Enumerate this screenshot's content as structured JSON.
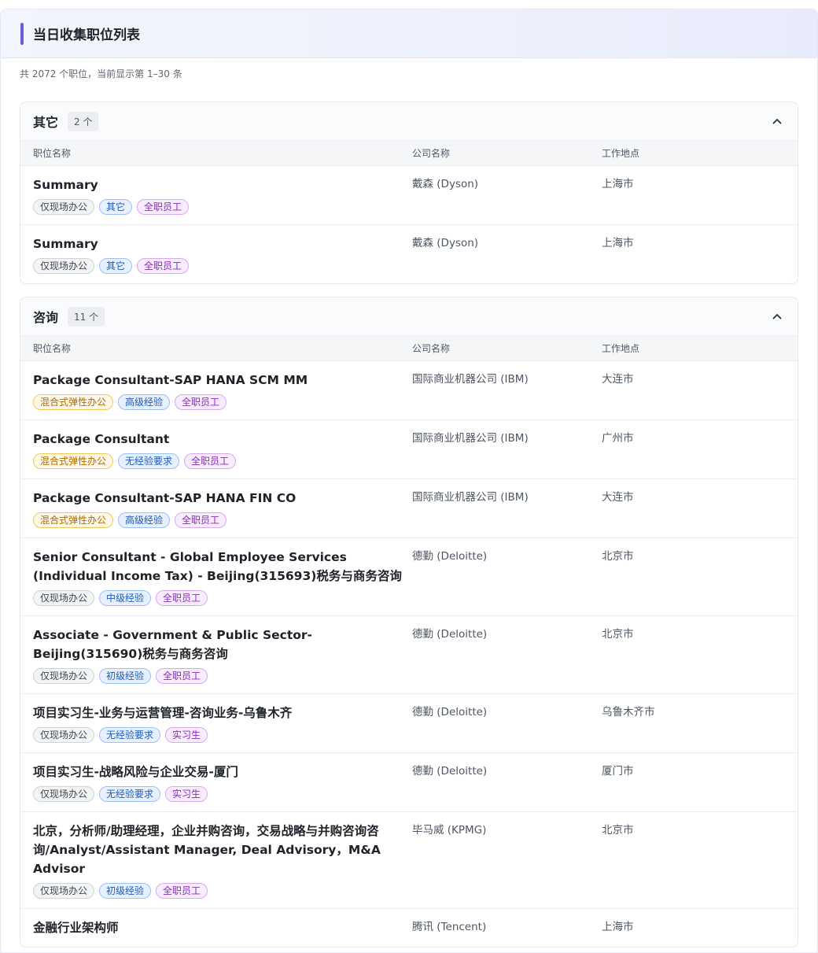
{
  "page": {
    "title": "当日收集职位列表",
    "summary": "共 2072 个职位，当前显示第 1–30 条"
  },
  "columns": {
    "title": "职位名称",
    "company": "公司名称",
    "location": "工作地点"
  },
  "groups": [
    {
      "name": "其它",
      "count": "2 个",
      "jobs": [
        {
          "title": "Summary",
          "company": "戴森 (Dyson)",
          "location": "上海市",
          "tags": [
            {
              "label": "仅现场办公",
              "tone": "gray"
            },
            {
              "label": "其它",
              "tone": "blue"
            },
            {
              "label": "全职员工",
              "tone": "purple"
            }
          ]
        },
        {
          "title": "Summary",
          "company": "戴森 (Dyson)",
          "location": "上海市",
          "tags": [
            {
              "label": "仅现场办公",
              "tone": "gray"
            },
            {
              "label": "其它",
              "tone": "blue"
            },
            {
              "label": "全职员工",
              "tone": "purple"
            }
          ]
        }
      ]
    },
    {
      "name": "咨询",
      "count": "11 个",
      "jobs": [
        {
          "title": "Package Consultant-SAP HANA SCM MM",
          "company": "国际商业机器公司 (IBM)",
          "location": "大连市",
          "tags": [
            {
              "label": "混合式弹性办公",
              "tone": "yellow"
            },
            {
              "label": "高级经验",
              "tone": "blue"
            },
            {
              "label": "全职员工",
              "tone": "purple"
            }
          ]
        },
        {
          "title": "Package Consultant",
          "company": "国际商业机器公司 (IBM)",
          "location": "广州市",
          "tags": [
            {
              "label": "混合式弹性办公",
              "tone": "yellow"
            },
            {
              "label": "无经验要求",
              "tone": "blue"
            },
            {
              "label": "全职员工",
              "tone": "purple"
            }
          ]
        },
        {
          "title": "Package Consultant-SAP HANA FIN CO",
          "company": "国际商业机器公司 (IBM)",
          "location": "大连市",
          "tags": [
            {
              "label": "混合式弹性办公",
              "tone": "yellow"
            },
            {
              "label": "高级经验",
              "tone": "blue"
            },
            {
              "label": "全职员工",
              "tone": "purple"
            }
          ]
        },
        {
          "title": "Senior Consultant - Global Employee Services (Individual Income Tax) - Beijing(315693)税务与商务咨询",
          "company": "德勤 (Deloitte)",
          "location": "北京市",
          "tags": [
            {
              "label": "仅现场办公",
              "tone": "gray"
            },
            {
              "label": "中级经验",
              "tone": "blue"
            },
            {
              "label": "全职员工",
              "tone": "purple"
            }
          ]
        },
        {
          "title": "Associate - Government & Public Sector-Beijing(315690)税务与商务咨询",
          "company": "德勤 (Deloitte)",
          "location": "北京市",
          "tags": [
            {
              "label": "仅现场办公",
              "tone": "gray"
            },
            {
              "label": "初级经验",
              "tone": "blue"
            },
            {
              "label": "全职员工",
              "tone": "purple"
            }
          ]
        },
        {
          "title": "项目实习生-业务与运营管理-咨询业务-乌鲁木齐",
          "company": "德勤 (Deloitte)",
          "location": "乌鲁木齐市",
          "tags": [
            {
              "label": "仅现场办公",
              "tone": "gray"
            },
            {
              "label": "无经验要求",
              "tone": "blue"
            },
            {
              "label": "实习生",
              "tone": "purple"
            }
          ]
        },
        {
          "title": "项目实习生-战略风险与企业交易-厦门",
          "company": "德勤 (Deloitte)",
          "location": "厦门市",
          "tags": [
            {
              "label": "仅现场办公",
              "tone": "gray"
            },
            {
              "label": "无经验要求",
              "tone": "blue"
            },
            {
              "label": "实习生",
              "tone": "purple"
            }
          ]
        },
        {
          "title": "北京，分析师/助理经理，企业并购咨询，交易战略与并购咨询咨询/Analyst/Assistant Manager, Deal Advisory，M&A Advisor",
          "company": "毕马威 (KPMG)",
          "location": "北京市",
          "tags": [
            {
              "label": "仅现场办公",
              "tone": "gray"
            },
            {
              "label": "初级经验",
              "tone": "blue"
            },
            {
              "label": "全职员工",
              "tone": "purple"
            }
          ]
        },
        {
          "title": "金融行业架构师",
          "company": "腾讯 (Tencent)",
          "location": "上海市",
          "tags": []
        }
      ]
    }
  ],
  "colors": {
    "accent": "#6b5fd6",
    "tag_blue": "#1e5bb8",
    "tag_purple": "#8a2cb5",
    "tag_yellow": "#b26a00"
  },
  "icons": {
    "collapse": "chevron-up-icon"
  }
}
